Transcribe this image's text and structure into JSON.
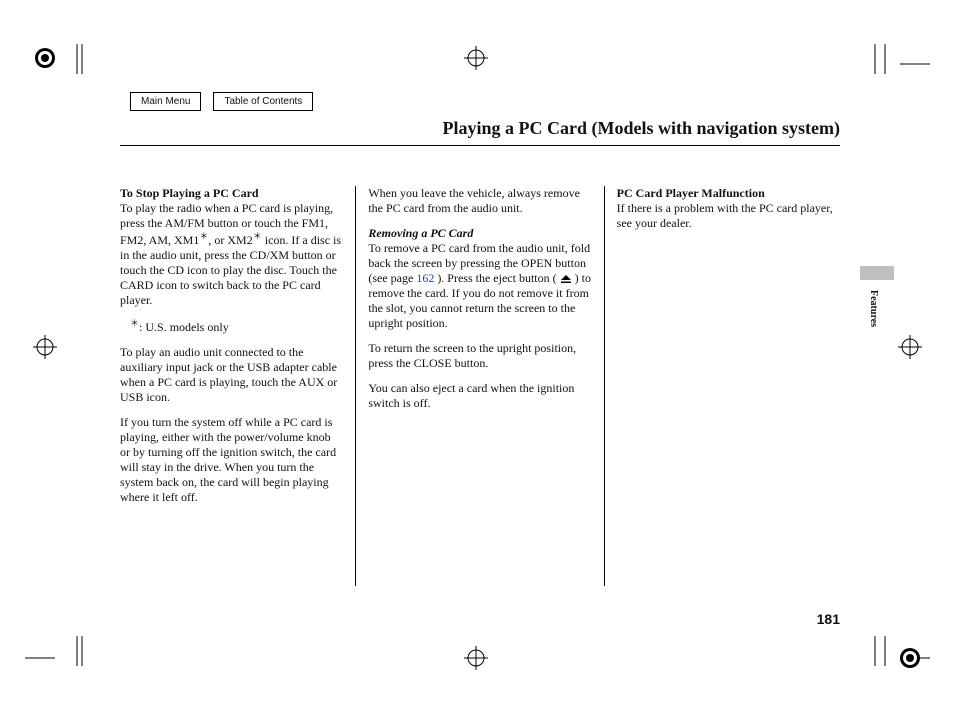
{
  "nav": {
    "main_menu": "Main Menu",
    "toc": "Table of Contents"
  },
  "title": "Playing a PC Card (Models with navigation system)",
  "col1": {
    "head1": "To Stop Playing a PC Card",
    "p1a": "To play the radio when a PC card is playing, press the AM/FM button or touch the FM1, FM2, AM, XM1",
    "p1b": ", or XM2",
    "p1c": " icon. If a disc is in the audio unit, press the CD/XM button or touch the CD icon to play the disc. Touch the CARD icon to switch back to the PC card player.",
    "note": ":  U.S. models only",
    "p2": "To play an audio unit connected to the auxiliary input jack or the USB adapter cable when a PC card is playing, touch the AUX or USB icon.",
    "p3": "If you turn the system off while a PC card is playing, either with the power/volume knob or by turning off the ignition switch, the card will stay in the drive. When you turn the system back on, the card will begin playing where it left off."
  },
  "col2": {
    "p1": "When you leave the vehicle, always remove the PC card from the audio unit.",
    "head2": "Removing a PC Card",
    "p2a": "To remove a PC card from the audio unit, fold back the screen by pressing the OPEN button (see page ",
    "p2ref": "162",
    "p2b": " ). Press the eject button ( ",
    "p2c": " ) to remove the card. If you do not remove it from the slot, you cannot return the screen to the upright position.",
    "p3": "To return the screen to the upright position, press the CLOSE button.",
    "p4": "You can also eject a card when the ignition switch is off."
  },
  "col3": {
    "head3": "PC Card Player Malfunction",
    "p1": "If there is a problem with the PC card player, see your dealer."
  },
  "side_tab": "Features",
  "page_number": "181"
}
